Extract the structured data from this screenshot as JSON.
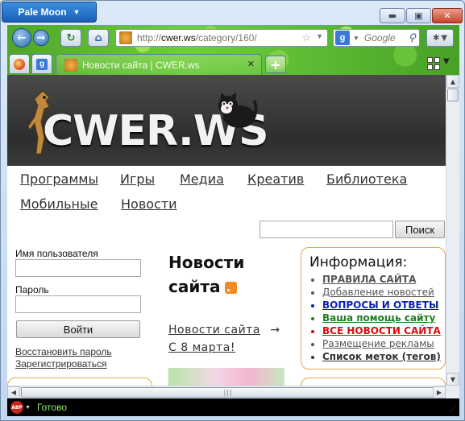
{
  "app": {
    "name": "Pale Moon"
  },
  "window": {
    "min": "▬",
    "max": "▣",
    "close": "✕"
  },
  "toolbar": {
    "url_scheme": "http://",
    "url_host": "cwer.ws",
    "url_path": "/category/160/",
    "search_placeholder": "Google",
    "search_engine_letter": "g"
  },
  "tabs": {
    "active_title": "Новости сайта | CWER.ws",
    "new_tab": "+"
  },
  "status": {
    "text": "Готово",
    "abp": "ABP"
  },
  "page": {
    "logo": "CWER.WS",
    "menu": [
      "Программы",
      "Игры",
      "Медиа",
      "Креатив",
      "Библиотека",
      "Мобильные",
      "Новости"
    ],
    "search_button": "Поиск",
    "login": {
      "username_label": "Имя пользователя",
      "password_label": "Пароль",
      "submit": "Войти",
      "restore": "Восстановить пароль",
      "register": "Зарегистрироваться"
    },
    "news": {
      "title": "Новости сайта",
      "link_line1": "Новости сайта",
      "arrow": "→",
      "link_line2": "С 8 марта!"
    },
    "info": {
      "title": "Информация:",
      "items": [
        {
          "label": "ПРАВИЛА САЙТА",
          "color": "#555555",
          "bold": true
        },
        {
          "label": "Добавление новостей",
          "color": "#555555",
          "bold": false
        },
        {
          "label": "ВОПРОСЫ И ОТВЕТЫ",
          "color": "#0a1fb3",
          "bold": true
        },
        {
          "label": "Ваша помощь сайту",
          "color": "#1f7d1f",
          "bold": true
        },
        {
          "label": "ВСЕ НОВОСТИ САЙТА",
          "color": "#d11010",
          "bold": true
        },
        {
          "label": "Размещение рекламы",
          "color": "#555555",
          "bold": false
        },
        {
          "label": "Список меток (тегов)",
          "color": "#333333",
          "bold": true
        }
      ]
    }
  },
  "colors": {
    "accent": "#e3a64a",
    "status_text": "#8cf06a",
    "banner": "#3a3a3a"
  }
}
